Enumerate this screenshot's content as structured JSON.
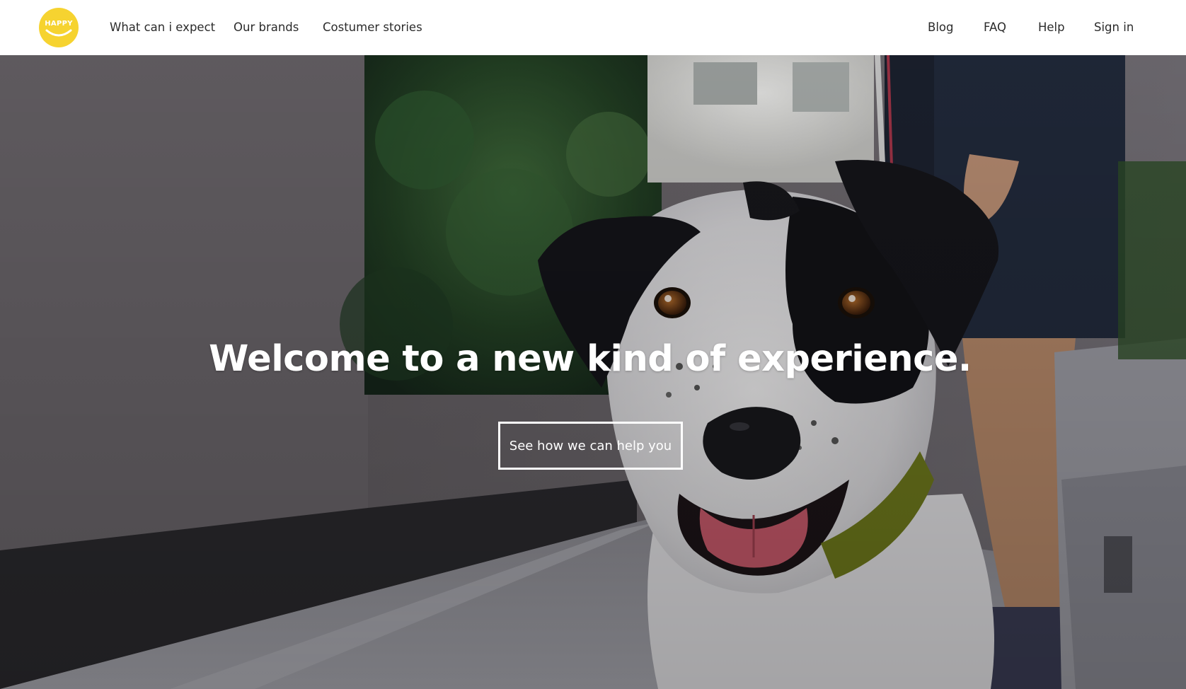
{
  "brand": {
    "logo_text": "HAPPY",
    "logo_color": "#f6d330"
  },
  "nav": {
    "left": [
      {
        "label": "What can i expect"
      },
      {
        "label": "Our brands"
      },
      {
        "label": "Costumer stories"
      }
    ],
    "right": [
      {
        "label": "Blog"
      },
      {
        "label": "FAQ"
      },
      {
        "label": "Help"
      },
      {
        "label": "Sign in"
      }
    ]
  },
  "hero": {
    "title": "Welcome to a new kind of experience.",
    "cta_label": "See how we can help you",
    "image_subject": "dog-photo"
  },
  "colors": {
    "header_bg": "#ffffff",
    "nav_text": "#2b2b2b",
    "hero_text": "#ffffff"
  }
}
